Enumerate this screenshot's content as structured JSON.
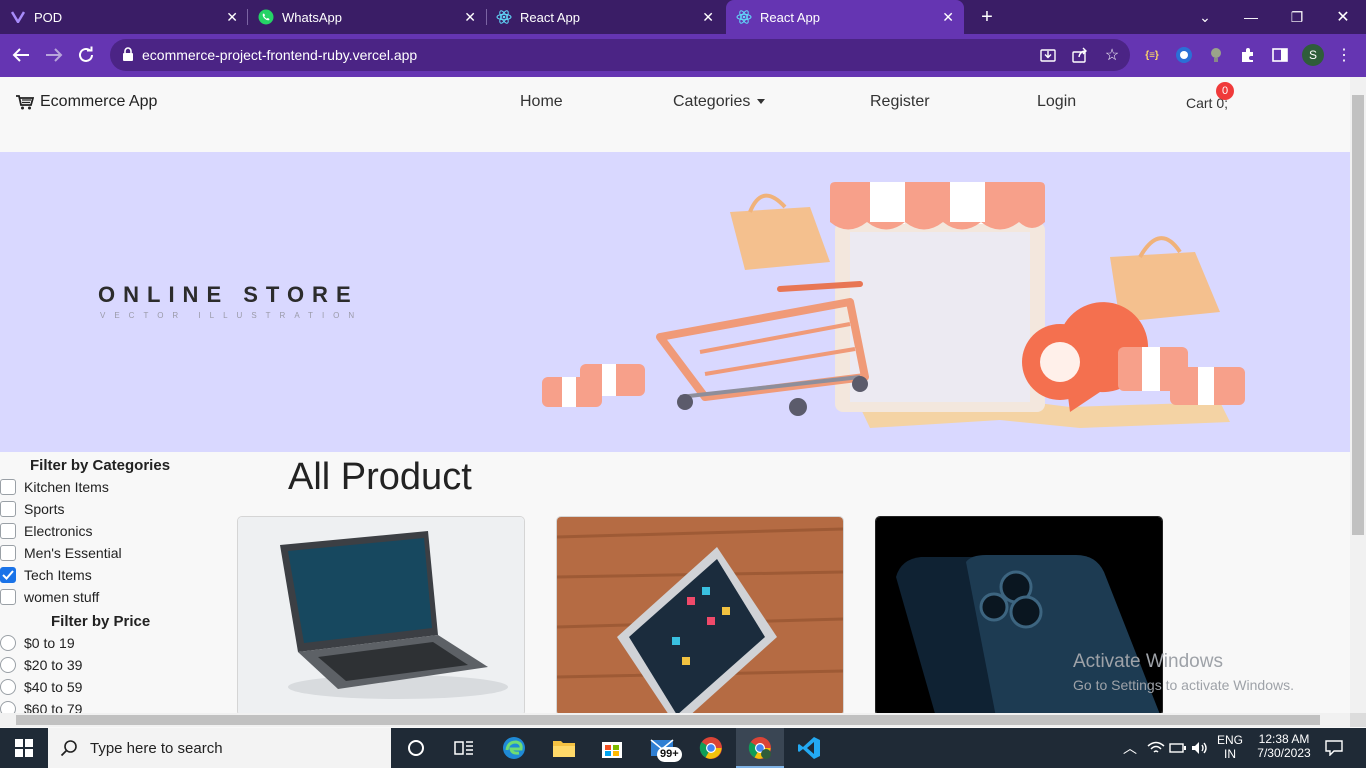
{
  "browser": {
    "tabs": [
      {
        "title": "POD",
        "icon": "vercel-v-icon"
      },
      {
        "title": "WhatsApp",
        "icon": "whatsapp-icon"
      },
      {
        "title": "React App",
        "icon": "react-icon"
      },
      {
        "title": "React App",
        "icon": "react-icon",
        "active": true
      }
    ],
    "new_tab": "+",
    "url": "ecommerce-project-frontend-ruby.vercel.app",
    "profile_initial": "S",
    "accent": "#6535b2",
    "tabbar_color": "#3a1d66"
  },
  "header": {
    "brand": "Ecommerce App",
    "menu": [
      "Home",
      "Categories",
      "Register",
      "Login"
    ],
    "cart_label": "Cart 0;",
    "cart_count": "0"
  },
  "hero": {
    "title": "ONLINE STORE",
    "subtitle": "VECTOR ILLUSTRATION",
    "bg_color": "#d9d8ff"
  },
  "filters": {
    "category_heading": "Filter by Categories",
    "categories": [
      {
        "label": "Kitchen Items",
        "checked": false
      },
      {
        "label": "Sports",
        "checked": false
      },
      {
        "label": "Electronics",
        "checked": false
      },
      {
        "label": "Men's Essential",
        "checked": false
      },
      {
        "label": "Tech Items",
        "checked": true
      },
      {
        "label": "women stuff",
        "checked": false
      }
    ],
    "price_heading": "Filter by Price",
    "prices": [
      "$0 to 19",
      "$20 to 39",
      "$40 to 59",
      "$60 to 79"
    ]
  },
  "products": {
    "heading": "All Product",
    "cards": [
      {
        "image": "laptop-image"
      },
      {
        "image": "tablet-image"
      },
      {
        "image": "smartphone-image"
      }
    ]
  },
  "watermark": {
    "line1": "Activate Windows",
    "line2": "Go to Settings to activate Windows."
  },
  "taskbar": {
    "search_placeholder": "Type here to search",
    "mail_badge": "99+",
    "language": "ENG",
    "region": "IN",
    "time": "12:38 AM",
    "date": "7/30/2023"
  }
}
